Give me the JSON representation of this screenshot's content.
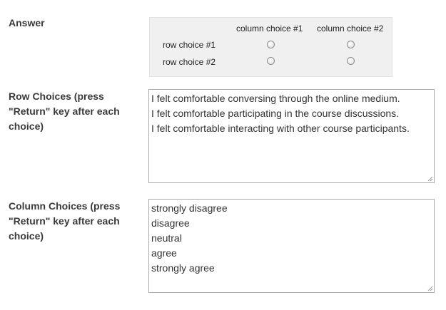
{
  "answer": {
    "label": "Answer",
    "columns": [
      "column choice #1",
      "column choice #2"
    ],
    "rows": [
      "row choice #1",
      "row choice #2"
    ]
  },
  "row_choices": {
    "label": "Row Choices (press \"Return\" key after each choice)",
    "lines": [
      "I felt comfortable conversing through the online medium.",
      "I felt comfortable participating in the course discussions.",
      "I felt comfortable interacting with other course participants."
    ]
  },
  "column_choices": {
    "label": "Column Choices (press \"Return\" key after each choice)",
    "lines": [
      "strongly disagree",
      "disagree",
      "neutral",
      "agree",
      "strongly agree"
    ]
  }
}
